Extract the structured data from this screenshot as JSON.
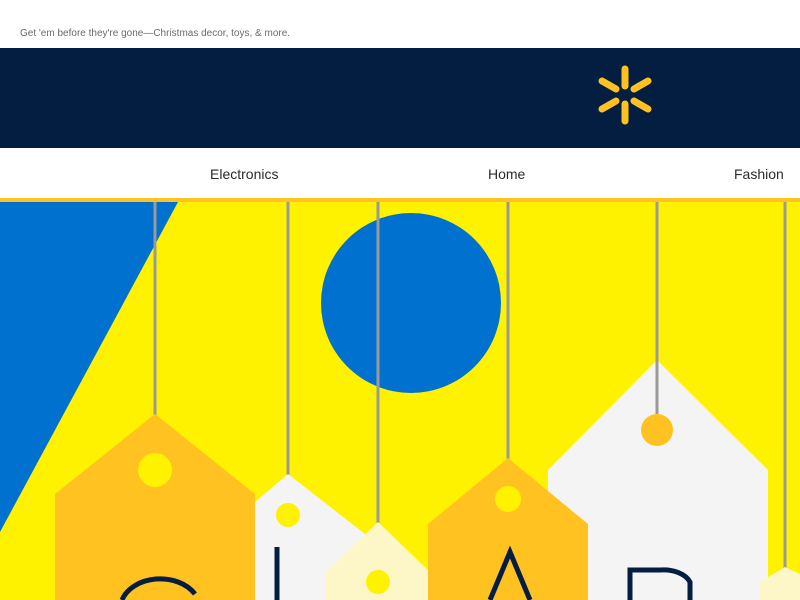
{
  "preheader": {
    "text": "Get 'em before they're gone—Christmas decor, toys, & more."
  },
  "brand": {
    "logo_icon": "spark-icon",
    "bar_color": "#041e42",
    "spark_color": "#ffc220"
  },
  "nav": {
    "items": [
      {
        "label": "Electronics"
      },
      {
        "label": "Home"
      },
      {
        "label": "Fashion"
      }
    ],
    "rule_color": "#ffc220"
  },
  "hero": {
    "background_color": "#fef200",
    "accent_blue": "#0071ce",
    "tag_orange": "#ffc220",
    "tag_white": "#f4f4f4",
    "letters": [
      "C",
      "L",
      "A",
      "R"
    ]
  }
}
